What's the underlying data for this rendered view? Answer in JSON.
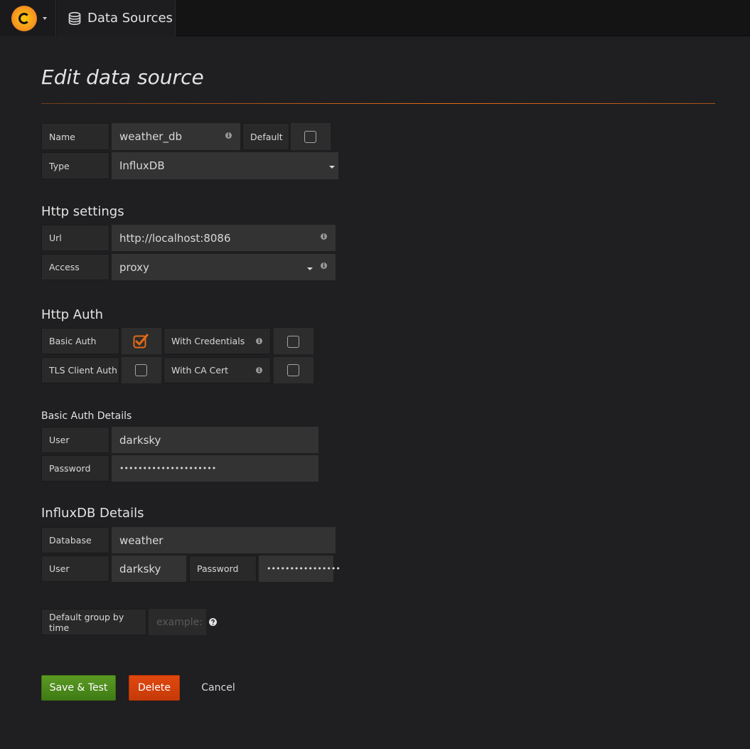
{
  "topbar": {
    "breadcrumb_label": "Data Sources"
  },
  "page": {
    "title": "Edit data source"
  },
  "general": {
    "name_label": "Name",
    "name_value": "weather_db",
    "default_label": "Default",
    "default_checked": false,
    "type_label": "Type",
    "type_value": "InfluxDB"
  },
  "http_settings": {
    "heading": "Http settings",
    "url_label": "Url",
    "url_value": "http://localhost:8086",
    "access_label": "Access",
    "access_value": "proxy"
  },
  "http_auth": {
    "heading": "Http Auth",
    "basic_auth_label": "Basic Auth",
    "basic_auth_checked": true,
    "with_credentials_label": "With Credentials",
    "with_credentials_checked": false,
    "tls_client_auth_label": "TLS Client Auth",
    "tls_client_auth_checked": false,
    "with_ca_cert_label": "With CA Cert",
    "with_ca_cert_checked": false
  },
  "basic_auth_details": {
    "heading": "Basic Auth Details",
    "user_label": "User",
    "user_value": "darksky",
    "password_label": "Password",
    "password_mask": "•••••••••••••••••••••"
  },
  "influxdb_details": {
    "heading": "InfluxDB Details",
    "database_label": "Database",
    "database_value": "weather",
    "user_label": "User",
    "user_value": "darksky",
    "password_label": "Password",
    "password_mask": "••••••••••••••••"
  },
  "group_by": {
    "label": "Default group by time",
    "placeholder": "example:"
  },
  "actions": {
    "save_label": "Save & Test",
    "delete_label": "Delete",
    "cancel_label": "Cancel"
  },
  "colors": {
    "accent": "#e36a17",
    "save": "#4f8c1b",
    "delete": "#d6440c"
  }
}
